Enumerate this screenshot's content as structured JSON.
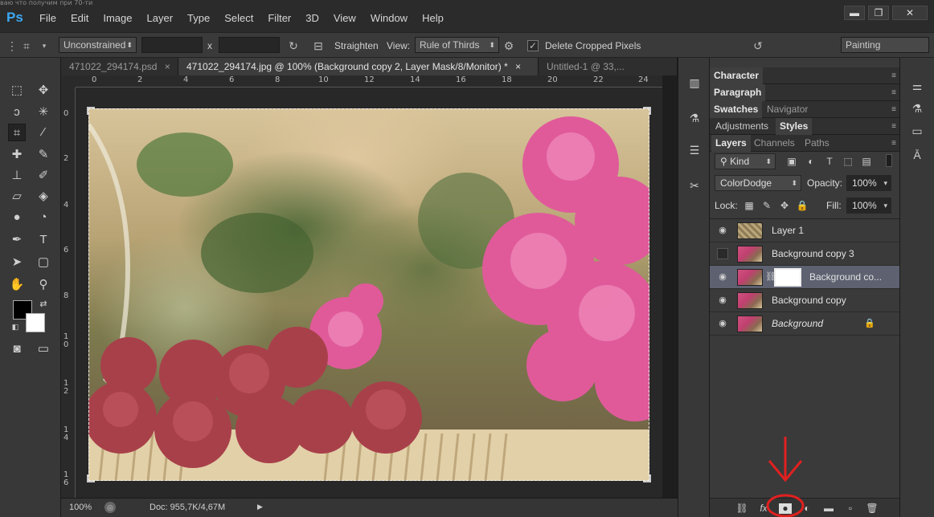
{
  "top_strip_text": "ваю что получим при 70-ти",
  "app": {
    "logo": "Ps"
  },
  "menu": [
    "File",
    "Edit",
    "Image",
    "Layer",
    "Type",
    "Select",
    "Filter",
    "3D",
    "View",
    "Window",
    "Help"
  ],
  "window_controls": {
    "minimize": "▬",
    "restore": "❐",
    "close": "✕"
  },
  "options_bar": {
    "ratio": "Unconstrained",
    "x_sep": "x",
    "straighten": "Straighten",
    "view_label": "View:",
    "view_value": "Rule of Thirds",
    "delete_cropped": "Delete Cropped Pixels",
    "delete_cropped_checked": true,
    "workspace": "Painting"
  },
  "doc_tabs": [
    {
      "label": "471022_294174.psd",
      "close": "×",
      "active": false
    },
    {
      "label": "471022_294174.jpg @ 100% (Background copy 2, Layer Mask/8/Monitor) *",
      "close": "×",
      "active": true
    },
    {
      "label": "Untitled-1 @ 33,...",
      "close": "",
      "active": false
    }
  ],
  "ruler_h": [
    "0",
    "2",
    "4",
    "6",
    "8",
    "10",
    "12",
    "14",
    "16",
    "18",
    "20",
    "22",
    "24"
  ],
  "ruler_v": [
    "0",
    "2",
    "4",
    "6",
    "8",
    "1 0",
    "1 2",
    "1 4",
    "1 6"
  ],
  "status": {
    "zoom": "100%",
    "doc": "Doc: 955,7K/4,67M",
    "arrow": "▶"
  },
  "panels": {
    "group1": [
      "Character"
    ],
    "group2": [
      "Paragraph"
    ],
    "group3": [
      "Swatches",
      "Navigator"
    ],
    "group4": [
      "Adjustments",
      "Styles"
    ],
    "layers_tabs": [
      "Layers",
      "Channels",
      "Paths"
    ],
    "kind": "Kind",
    "blend_mode": "ColorDodge",
    "opacity_label": "Opacity:",
    "opacity_value": "100%",
    "lock_label": "Lock:",
    "fill_label": "Fill:",
    "fill_value": "100%",
    "layers": [
      {
        "name": "Layer 1",
        "visible": true,
        "selected": false
      },
      {
        "name": "Background copy 3",
        "visible": false,
        "selected": false
      },
      {
        "name": "Background co...",
        "visible": true,
        "selected": true,
        "has_mask": true
      },
      {
        "name": "Background copy",
        "visible": true,
        "selected": false
      },
      {
        "name": "Background",
        "visible": true,
        "selected": false,
        "italic": true,
        "locked": true
      }
    ]
  },
  "annotation": {
    "arrow_color": "#e02020",
    "target": "add-layer-mask-button"
  }
}
